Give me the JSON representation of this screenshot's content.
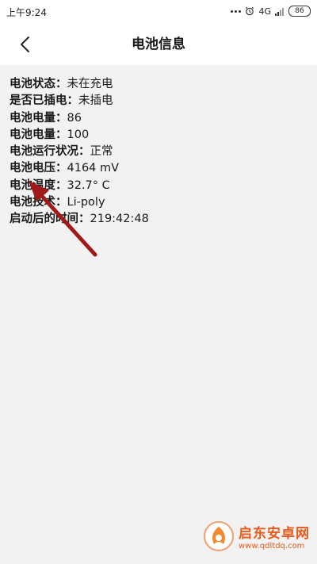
{
  "status_bar": {
    "time": "上午9:24",
    "network": "4G",
    "battery": "86"
  },
  "header": {
    "title": "电池信息"
  },
  "battery_info": {
    "rows": [
      {
        "label": "电池状态：",
        "value": "未在充电"
      },
      {
        "label": "是否已插电：",
        "value": "未插电"
      },
      {
        "label": "电池电量：",
        "value": "86"
      },
      {
        "label": "电池电量：",
        "value": "100"
      },
      {
        "label": "电池运行状况：",
        "value": "正常"
      },
      {
        "label": "电池电压：",
        "value": "4164 mV"
      },
      {
        "label": "电池温度：",
        "value": "32.7° C"
      },
      {
        "label": "电池技术：",
        "value": "Li-poly"
      },
      {
        "label": "启动后的时间：",
        "value": "219:42:48"
      }
    ]
  },
  "annotation": {
    "icon": "red-arrow-icon",
    "color": "#a11a1a"
  },
  "watermark": {
    "name": "启东安卓网",
    "url": "www.qdltdq.com",
    "color": "#e85a1c"
  }
}
